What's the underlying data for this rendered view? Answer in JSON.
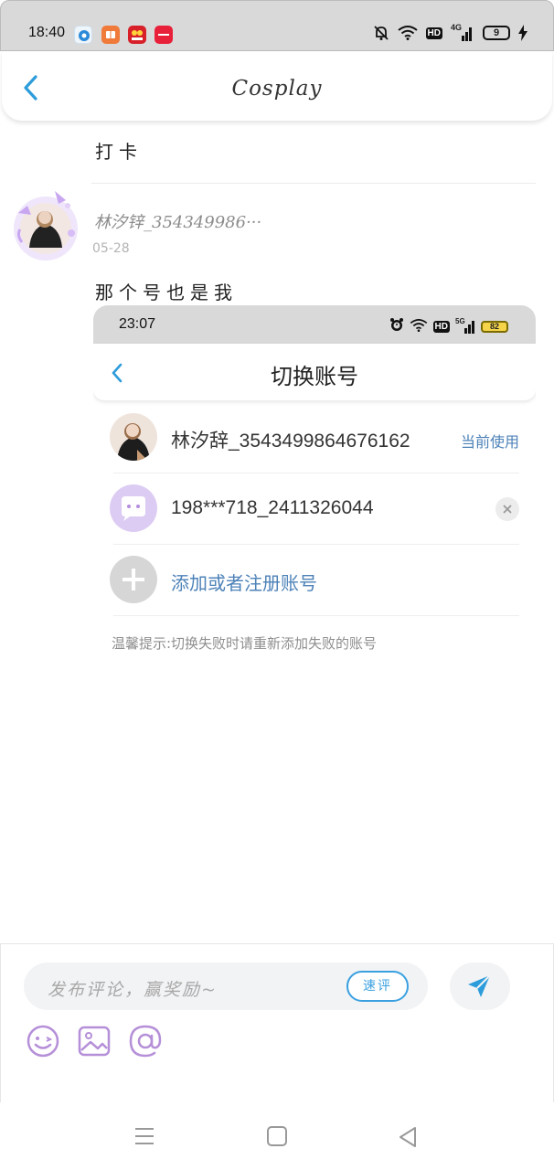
{
  "status_bar": {
    "time": "18:40",
    "app_icons": [
      "qq-browser-icon",
      "book-app-icon",
      "shopping-618-icon",
      "red-app-icon"
    ],
    "battery": "9",
    "network": "4G",
    "hd": "HD"
  },
  "header": {
    "title": "Cosplay",
    "back_icon": "chevron-left-icon"
  },
  "feed": {
    "previous_comment": "打卡",
    "post": {
      "username": "林汐锌_354349986···",
      "date": "05-28",
      "text": "那个号也是我"
    }
  },
  "screenshot": {
    "status_time": "23:07",
    "network": "5G",
    "hd": "HD",
    "battery": "82",
    "title": "切换账号",
    "accounts": [
      {
        "name": "林汐辞_3543499864676162",
        "status": "当前使用"
      },
      {
        "name": "198***718_2411326044"
      }
    ],
    "add_account": "添加或者注册账号",
    "tip": "温馨提示:切换失败时请重新添加失败的账号"
  },
  "composer": {
    "placeholder": "发布评论，赢奖励~",
    "quick_reply_label": "速评",
    "tools": [
      "emoji-icon",
      "image-icon",
      "mention-icon"
    ]
  },
  "colors": {
    "accent": "#3aa0e0",
    "link": "#4d82b8",
    "tool_purple": "#b58fd8"
  }
}
